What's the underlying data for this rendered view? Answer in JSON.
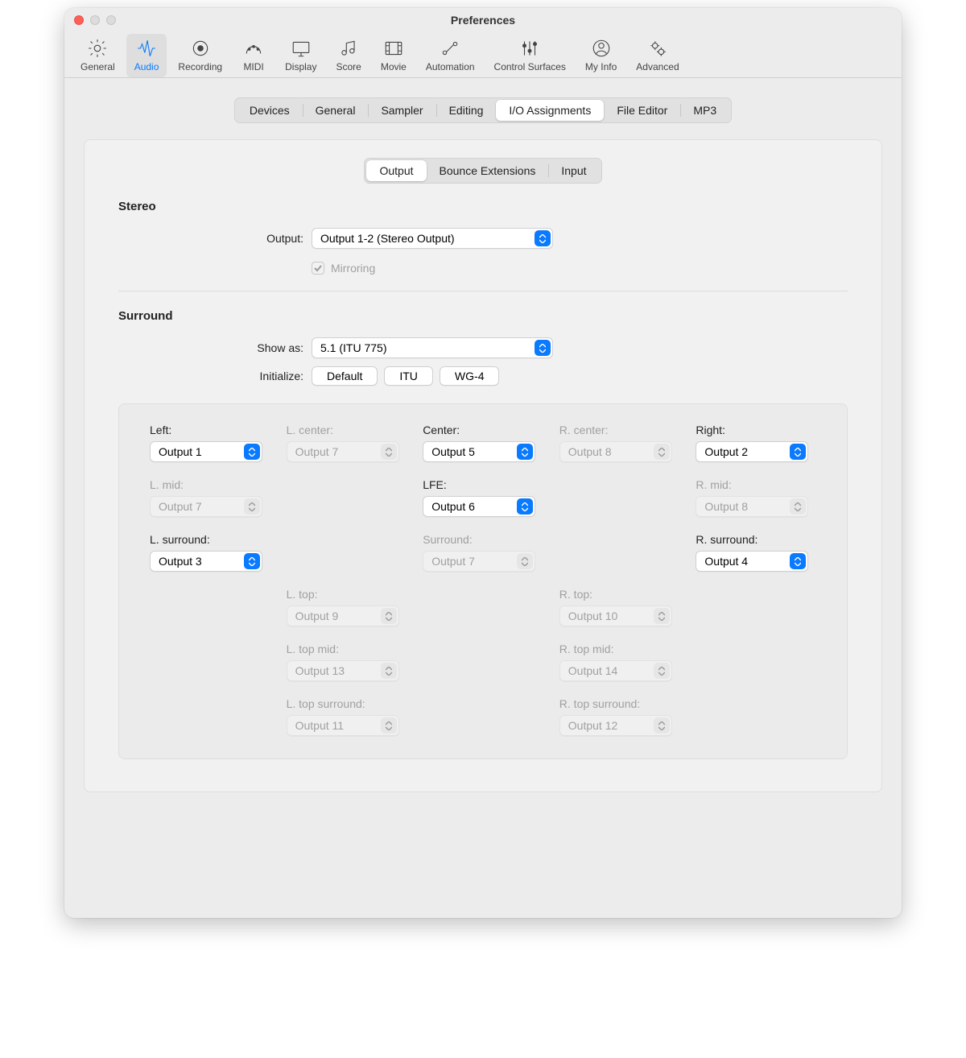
{
  "window_title": "Preferences",
  "toolbar": [
    {
      "key": "general",
      "label": "General"
    },
    {
      "key": "audio",
      "label": "Audio",
      "active": true
    },
    {
      "key": "recording",
      "label": "Recording"
    },
    {
      "key": "midi",
      "label": "MIDI"
    },
    {
      "key": "display",
      "label": "Display"
    },
    {
      "key": "score",
      "label": "Score"
    },
    {
      "key": "movie",
      "label": "Movie"
    },
    {
      "key": "automation",
      "label": "Automation"
    },
    {
      "key": "control_surfaces",
      "label": "Control Surfaces"
    },
    {
      "key": "my_info",
      "label": "My Info"
    },
    {
      "key": "advanced",
      "label": "Advanced"
    }
  ],
  "tabs1": [
    "Devices",
    "General",
    "Sampler",
    "Editing",
    "I/O Assignments",
    "File Editor",
    "MP3"
  ],
  "tabs1_active": "I/O Assignments",
  "tabs2": [
    "Output",
    "Bounce Extensions",
    "Input"
  ],
  "tabs2_active": "Output",
  "stereo": {
    "title": "Stereo",
    "output_label": "Output:",
    "output_value": "Output 1-2 (Stereo Output)",
    "mirroring_label": "Mirroring",
    "mirroring_checked": true,
    "mirroring_disabled": true
  },
  "surround": {
    "title": "Surround",
    "show_as_label": "Show as:",
    "show_as_value": "5.1 (ITU 775)",
    "initialize_label": "Initialize:",
    "init_buttons": [
      "Default",
      "ITU",
      "WG-4"
    ]
  },
  "grid": {
    "r1": [
      {
        "label": "Left:",
        "value": "Output 1",
        "enabled": true,
        "col": 1
      },
      {
        "label": "L. center:",
        "value": "Output 7",
        "enabled": false,
        "col": 2
      },
      {
        "label": "Center:",
        "value": "Output 5",
        "enabled": true,
        "col": 3
      },
      {
        "label": "R. center:",
        "value": "Output 8",
        "enabled": false,
        "col": 4
      },
      {
        "label": "Right:",
        "value": "Output 2",
        "enabled": true,
        "col": 5
      }
    ],
    "r2": [
      {
        "label": "L. mid:",
        "value": "Output 7",
        "enabled": false,
        "col": 1
      },
      {
        "label": "LFE:",
        "value": "Output 6",
        "enabled": true,
        "col": 3
      },
      {
        "label": "R. mid:",
        "value": "Output 8",
        "enabled": false,
        "col": 5
      }
    ],
    "r3": [
      {
        "label": "L. surround:",
        "value": "Output 3",
        "enabled": true,
        "col": 1
      },
      {
        "label": "Surround:",
        "value": "Output 7",
        "enabled": false,
        "col": 3
      },
      {
        "label": "R. surround:",
        "value": "Output 4",
        "enabled": true,
        "col": 5
      }
    ],
    "r4": [
      {
        "label": "L. top:",
        "value": "Output 9",
        "enabled": false,
        "col": 2
      },
      {
        "label": "R. top:",
        "value": "Output 10",
        "enabled": false,
        "col": 4
      }
    ],
    "r5": [
      {
        "label": "L. top mid:",
        "value": "Output 13",
        "enabled": false,
        "col": 2
      },
      {
        "label": "R. top mid:",
        "value": "Output 14",
        "enabled": false,
        "col": 4
      }
    ],
    "r6": [
      {
        "label": "L. top surround:",
        "value": "Output 11",
        "enabled": false,
        "col": 2
      },
      {
        "label": "R. top surround:",
        "value": "Output 12",
        "enabled": false,
        "col": 4
      }
    ]
  }
}
